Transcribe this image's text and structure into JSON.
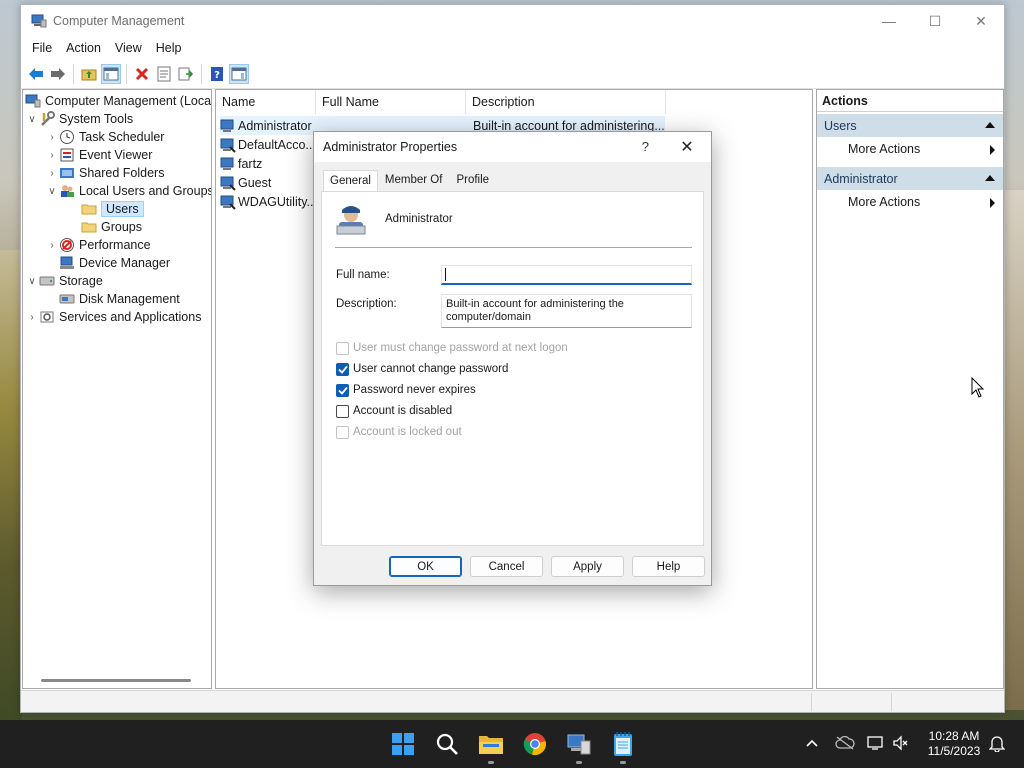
{
  "window": {
    "title": "Computer Management",
    "controls": {
      "minimize": "—",
      "maximize": "☐",
      "close": "✕"
    }
  },
  "menu": [
    "File",
    "Action",
    "View",
    "Help"
  ],
  "toolbar_icons": [
    "back-arrow-icon",
    "forward-arrow-icon",
    "up-folder-icon",
    "show-hide-tree-icon",
    "delete-icon",
    "properties-icon",
    "export-list-icon",
    "help-icon",
    "show-hide-action-pane-icon"
  ],
  "tree": {
    "root": "Computer Management (Local",
    "system_tools": "System Tools",
    "task_scheduler": "Task Scheduler",
    "event_viewer": "Event Viewer",
    "shared_folders": "Shared Folders",
    "local_users_groups": "Local Users and Groups",
    "users": "Users",
    "groups": "Groups",
    "performance": "Performance",
    "device_manager": "Device Manager",
    "storage": "Storage",
    "disk_management": "Disk Management",
    "services_apps": "Services and Applications"
  },
  "list": {
    "columns": [
      "Name",
      "Full Name",
      "Description"
    ],
    "rows": [
      {
        "name": "Administrator",
        "description": "Built-in account for administering..."
      },
      {
        "name": "DefaultAcco..."
      },
      {
        "name": "fartz"
      },
      {
        "name": "Guest"
      },
      {
        "name": "WDAGUtility..."
      }
    ]
  },
  "actions": {
    "title": "Actions",
    "section1": "Users",
    "section1_item": "More Actions",
    "section2": "Administrator",
    "section2_item": "More Actions"
  },
  "dialog": {
    "title": "Administrator Properties",
    "help_glyph": "?",
    "close_glyph": "✕",
    "tabs": [
      "General",
      "Member Of",
      "Profile"
    ],
    "username": "Administrator",
    "fullname_label": "Full name:",
    "fullname_value": "",
    "description_label": "Description:",
    "description_value": "Built-in account for administering the computer/domain",
    "checkboxes": [
      {
        "label": "User must change password at next logon",
        "checked": false,
        "disabled": true
      },
      {
        "label": "User cannot change password",
        "checked": true,
        "disabled": false
      },
      {
        "label": "Password never expires",
        "checked": true,
        "disabled": false
      },
      {
        "label": "Account is disabled",
        "checked": false,
        "disabled": false
      },
      {
        "label": "Account is locked out",
        "checked": false,
        "disabled": true
      }
    ],
    "buttons": {
      "ok": "OK",
      "cancel": "Cancel",
      "apply": "Apply",
      "help": "Help"
    }
  },
  "taskbar": {
    "time": "10:28 AM",
    "date": "11/5/2023",
    "apps": [
      "start-icon",
      "search-icon",
      "file-explorer-icon",
      "chrome-icon",
      "computer-management-icon",
      "notepad-icon"
    ]
  },
  "colors": {
    "accent": "#0f5cb4",
    "action_section": "#cfdde9",
    "taskbar": "#202020"
  }
}
